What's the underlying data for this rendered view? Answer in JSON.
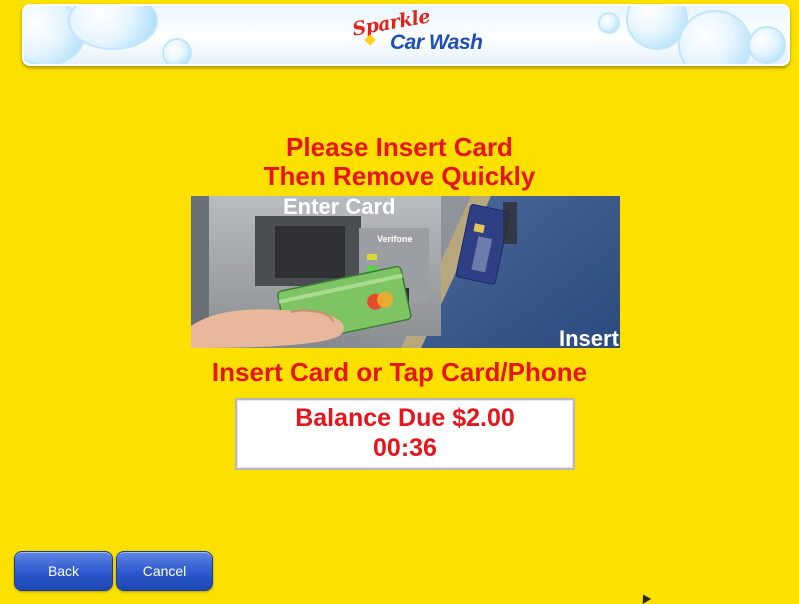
{
  "app": {
    "logo_script": "Sparkle",
    "logo_text": "Car Wash"
  },
  "instructions": {
    "line1": "Please Insert Card",
    "line2": "Then Remove Quickly"
  },
  "card_reader_image": {
    "enter_card_text": "Enter Card",
    "brand_text": "Verifone",
    "insert_text": "Insert"
  },
  "payment_prompt": "Insert Card or Tap Card/Phone",
  "balance": {
    "label": "Balance Due $2.00",
    "timer": "00:36"
  },
  "buttons": {
    "back": "Back",
    "cancel": "Cancel"
  },
  "colors": {
    "background": "#fbe000",
    "text_accent": "#e8141b",
    "button_blue": "#2d58cc",
    "logo_red": "#e2231a",
    "logo_blue": "#1e4fb4"
  }
}
